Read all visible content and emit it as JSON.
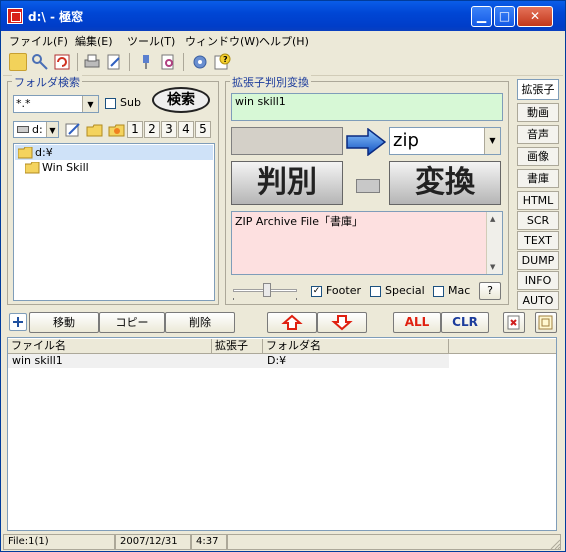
{
  "window": {
    "title": "d:\\ - 極窓"
  },
  "menu": [
    "ファイル(F)",
    "編集(E)",
    "ツール(T)",
    "ウィンドウ(W)",
    "ヘルプ(H)"
  ],
  "folder_search": {
    "title": "フォルダ検索",
    "pattern": "*.*",
    "sub_label": "Sub",
    "search_button": "検索",
    "drive": "d:",
    "digits": [
      "1",
      "2",
      "3",
      "4",
      "5"
    ],
    "tree": [
      {
        "label": "d:¥",
        "selected": true
      },
      {
        "label": "Win Skill",
        "selected": false
      }
    ]
  },
  "ext_detect": {
    "title": "拡張子判別変換",
    "input_text": "win skill1",
    "result_ext": "zip",
    "detect_button": "判別",
    "convert_button": "変換",
    "description": "ZIP Archive File「書庫」",
    "footer_label": "Footer",
    "footer_checked": true,
    "special_label": "Special",
    "mac_label": "Mac",
    "help_button": "?"
  },
  "side_tabs": [
    "拡張子",
    "動画",
    "音声",
    "画像",
    "書庫",
    "HTML",
    "SCR",
    "TEXT",
    "DUMP",
    "INFO",
    "AUTO"
  ],
  "actions": {
    "move": "移動",
    "copy": "コピー",
    "delete": "削除",
    "all": "ALL",
    "clr": "CLR"
  },
  "list": {
    "columns": [
      "ファイル名",
      "拡張子",
      "フォルダ名"
    ],
    "rows": [
      {
        "name": "win skill1",
        "ext": "",
        "folder": "D:¥"
      }
    ]
  },
  "status": {
    "files": "File:1(1)",
    "date": "2007/12/31",
    "time": "4:37"
  },
  "colors": {
    "title_blue": "#0046d5",
    "input_green": "#d7f8d6",
    "desc_pink": "#fde0e0",
    "arrow_red": "#e02010",
    "brand_blue": "#1c3c9c"
  }
}
